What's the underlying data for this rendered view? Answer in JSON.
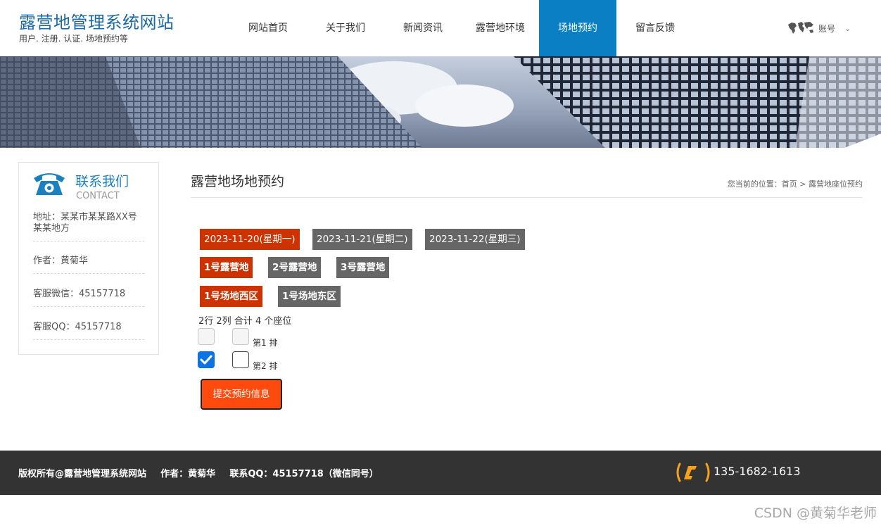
{
  "header": {
    "site_title": "露营地管理系统网站",
    "site_subtitle": "用户. 注册. 认证. 场地预约等",
    "nav": [
      "网站首页",
      "关于我们",
      "新闻资讯",
      "露营地环境",
      "场地预约",
      "留言反馈"
    ],
    "active_nav": "场地预约",
    "account_label": "账号",
    "accent_color": "#0a7fc3"
  },
  "sidebar": {
    "title": "联系我们",
    "title_en": "CONTACT",
    "address": "地址：某某市某某路XX号某某地方",
    "author": "作者：黄菊华",
    "wechat": "客服微信：45157718",
    "qq": "客服QQ：45157718"
  },
  "main": {
    "page_title": "露营地场地预约",
    "breadcrumb_prefix": "您当前的位置：",
    "breadcrumb_home": "首页",
    "breadcrumb_sep": ">",
    "breadcrumb_current": "露营地座位预约",
    "dates": [
      {
        "label": "2023-11-20(星期一)",
        "selected": true
      },
      {
        "label": "2023-11-21(星期二)",
        "selected": false
      },
      {
        "label": "2023-11-22(星期三)",
        "selected": false
      }
    ],
    "camps": [
      {
        "label": "1号露营地",
        "selected": true
      },
      {
        "label": "2号露营地",
        "selected": false
      },
      {
        "label": "3号露营地",
        "selected": false
      }
    ],
    "areas": [
      {
        "label": "1号场地西区",
        "selected": true
      },
      {
        "label": "1号场地东区",
        "selected": false
      }
    ],
    "seat_summary": "2行 2列 合计 4 个座位",
    "rows": [
      {
        "label": "第1 排",
        "seats": [
          "disabled",
          "disabled"
        ]
      },
      {
        "label": "第2 排",
        "seats": [
          "checked",
          "unchecked"
        ]
      }
    ],
    "submit_label": "提交预约信息",
    "selected_color": "#cc3300",
    "submit_color": "#ff4a0e"
  },
  "footer": {
    "copyright": "版权所有@露营地管理系统网站",
    "author": "作者：黄菊华",
    "contact": "联系QQ：45157718（微信同号）",
    "phone": "135-1682-1613"
  },
  "watermark": "CSDN @黄菊华老师"
}
